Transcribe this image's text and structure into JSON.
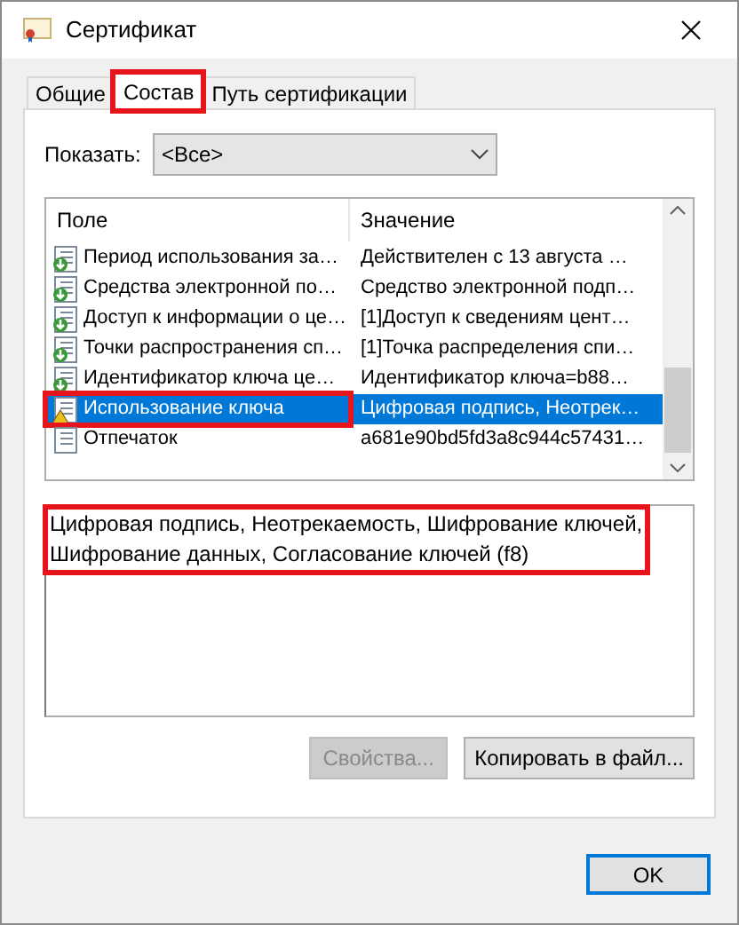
{
  "window": {
    "title": "Сертификат"
  },
  "tabs": [
    {
      "label": "Общие",
      "selected": false,
      "highlighted": false
    },
    {
      "label": "Состав",
      "selected": true,
      "highlighted": true
    },
    {
      "label": "Путь сертификации",
      "selected": false,
      "highlighted": false
    }
  ],
  "show_filter": {
    "label": "Показать:",
    "value": "<Все>"
  },
  "table": {
    "columns": [
      "Поле",
      "Значение"
    ],
    "rows": [
      {
        "kind": "extension",
        "field": "Период использования за…",
        "value": "Действителен с 13 августа …",
        "selected": false,
        "highlighted": false
      },
      {
        "kind": "extension",
        "field": "Средства электронной по…",
        "value": "Средство электронной подп…",
        "selected": false,
        "highlighted": false
      },
      {
        "kind": "extension",
        "field": "Доступ к информации о це…",
        "value": "[1]Доступ к сведениям цент…",
        "selected": false,
        "highlighted": false
      },
      {
        "kind": "extension",
        "field": "Точки распространения сп…",
        "value": "[1]Точка распределения спи…",
        "selected": false,
        "highlighted": false
      },
      {
        "kind": "extension",
        "field": "Идентификатор ключа це…",
        "value": "Идентификатор ключа=b88…",
        "selected": false,
        "highlighted": false
      },
      {
        "kind": "critical",
        "field": "Использование ключа",
        "value": "Цифровая подпись, Неотрек…",
        "selected": true,
        "highlighted": true
      },
      {
        "kind": "property",
        "field": "Отпечаток",
        "value": "a681e90bd5fd3a8c944c57431…",
        "selected": false,
        "highlighted": false
      }
    ]
  },
  "details": {
    "lines": [
      "Цифровая подпись, Неотрекаемость, Шифрование ключей,",
      "Шифрование данных, Согласование ключей (f8)"
    ],
    "highlighted": true
  },
  "buttons": [
    {
      "label": "Свойства...",
      "disabled": true
    },
    {
      "label": "Копировать в файл...",
      "disabled": false
    }
  ],
  "ok_button": {
    "label": "OK"
  }
}
